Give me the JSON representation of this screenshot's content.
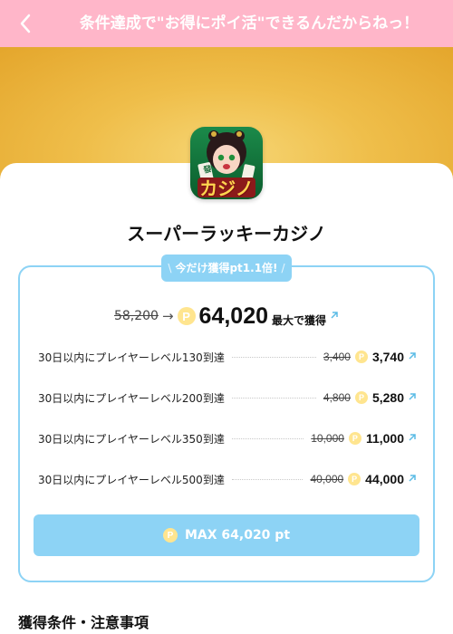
{
  "header": {
    "title": "条件達成で\"お得にポイ活\"できるんだからねっ！"
  },
  "app": {
    "name": "スーパーラッキーカジノ",
    "icon_text": "カジノ",
    "tile_text": "發"
  },
  "bonus": {
    "label": "今だけ獲得pt1.1倍!"
  },
  "total": {
    "old": "58,200",
    "new": "64,020",
    "suffix": "最大で獲得"
  },
  "conditions": [
    {
      "label": "30日以内にプレイヤーレベル130到達",
      "old": "3,400",
      "new": "3,740"
    },
    {
      "label": "30日以内にプレイヤーレベル200到達",
      "old": "4,800",
      "new": "5,280"
    },
    {
      "label": "30日以内にプレイヤーレベル350到達",
      "old": "10,000",
      "new": "11,000"
    },
    {
      "label": "30日以内にプレイヤーレベル500到達",
      "old": "40,000",
      "new": "44,000"
    }
  ],
  "max_button": {
    "label": "MAX 64,020 pt"
  },
  "section": {
    "title": "獲得条件・注意事項"
  },
  "colors": {
    "header_bg": "#ffb6c9",
    "accent_blue": "#8dd3f5",
    "coin": "#ffe58f",
    "hero_gold": "#efbe4a"
  },
  "icons": {
    "back": "chevron-left-icon",
    "coin": "p-coin-icon",
    "external": "external-link-icon"
  }
}
